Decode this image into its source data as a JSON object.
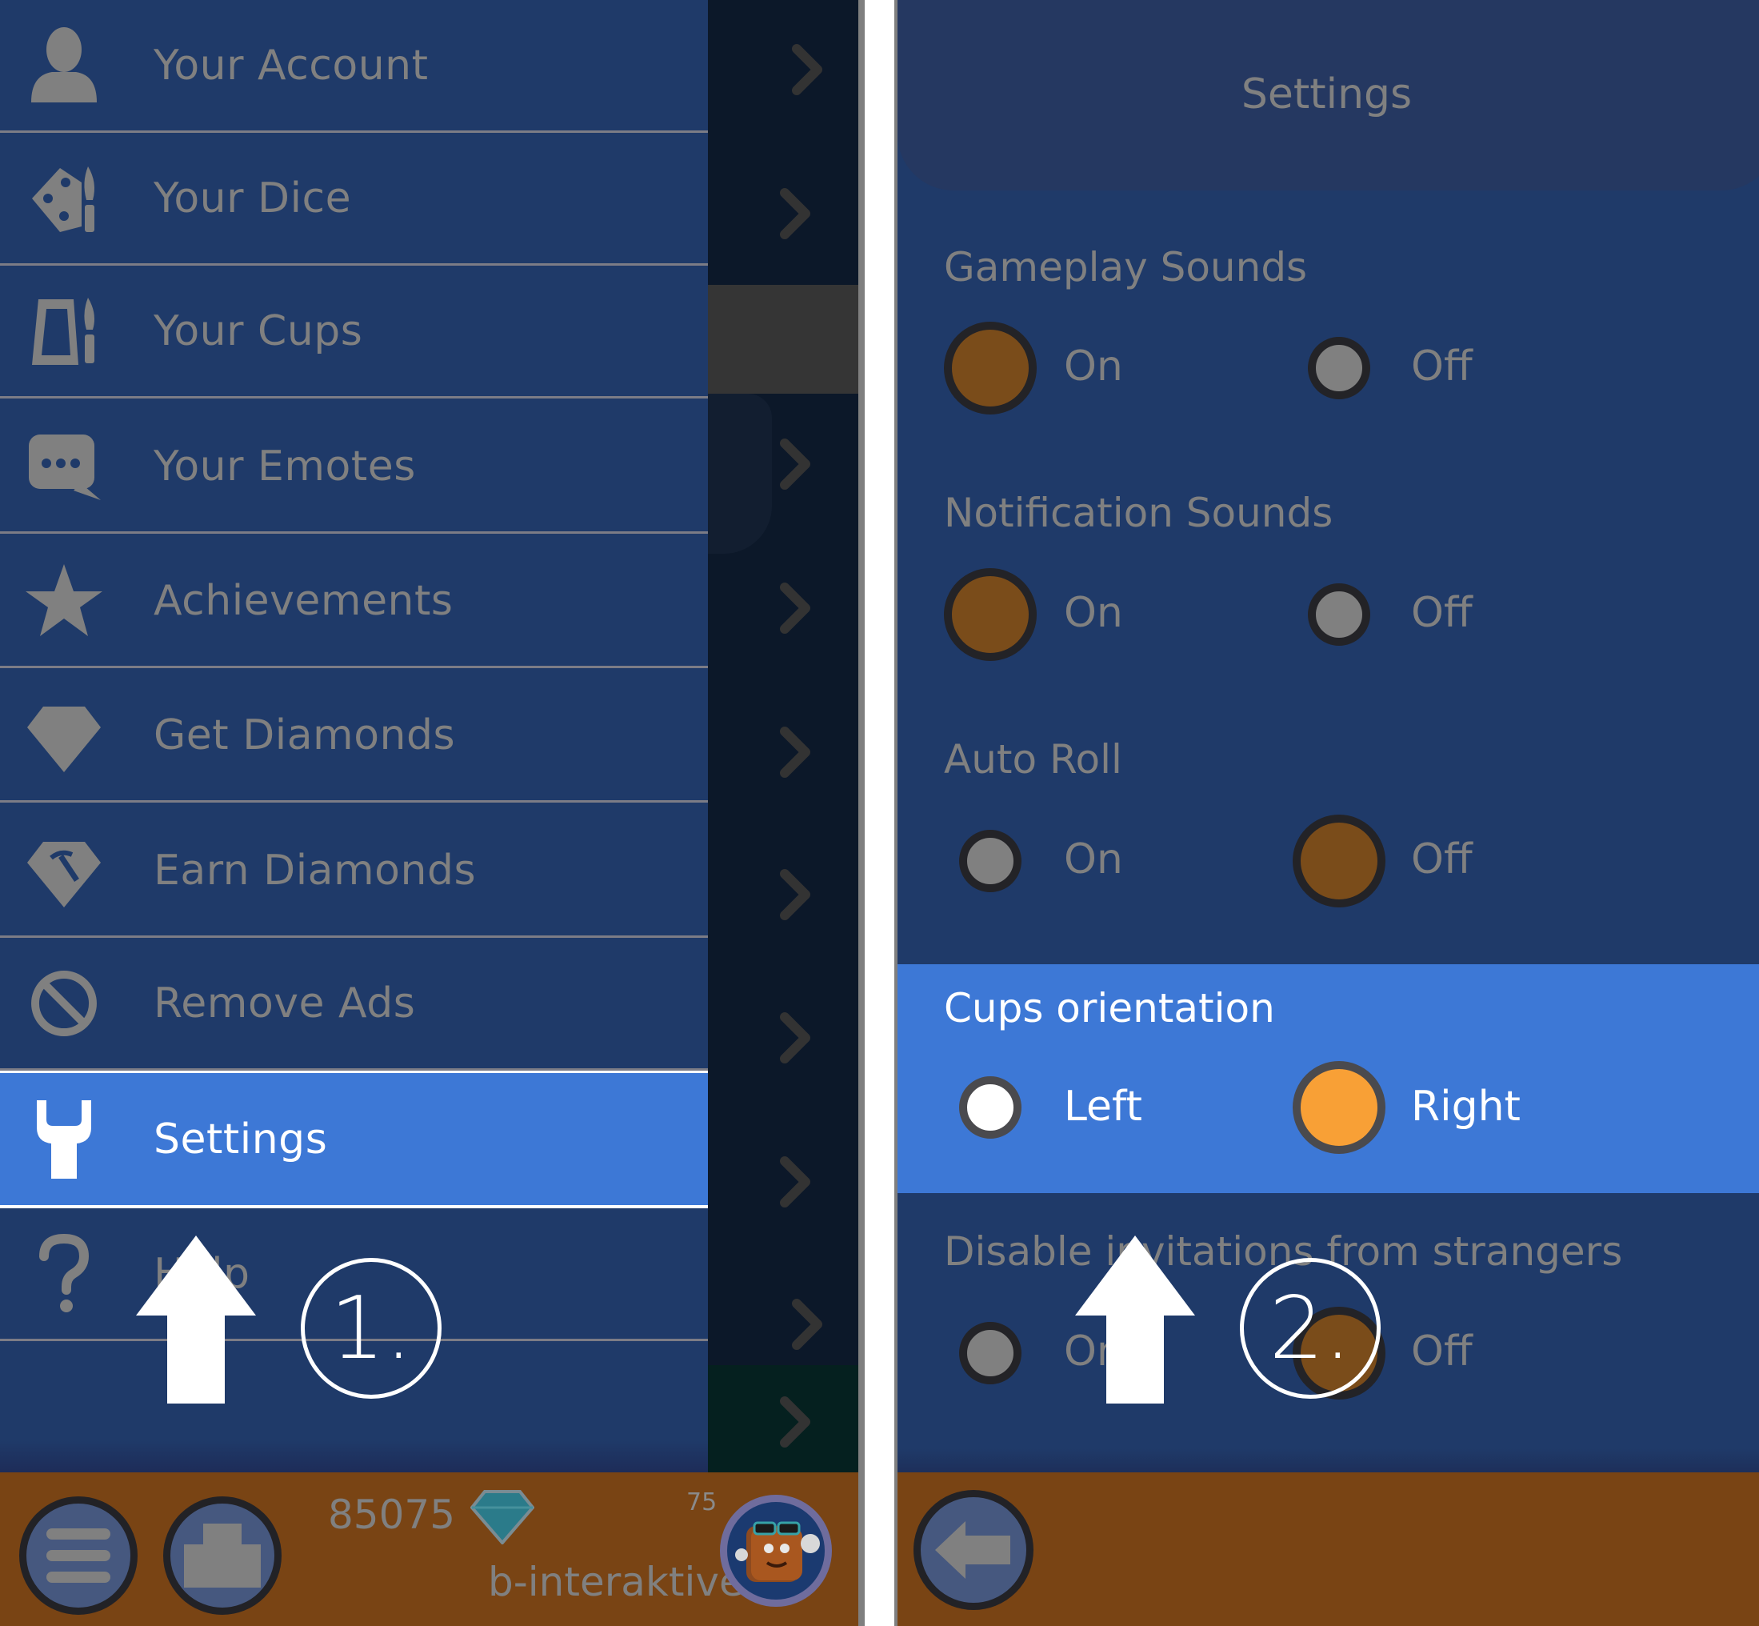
{
  "menu": {
    "items": [
      {
        "label": "Your Account",
        "icon": "user-icon"
      },
      {
        "label": "Your Dice",
        "icon": "dice-brush-icon"
      },
      {
        "label": "Your Cups",
        "icon": "cup-brush-icon"
      },
      {
        "label": "Your Emotes",
        "icon": "chat-bubble-icon"
      },
      {
        "label": "Achievements",
        "icon": "star-icon"
      },
      {
        "label": "Get Diamonds",
        "icon": "diamond-icon"
      },
      {
        "label": "Earn Diamonds",
        "icon": "diamond-pickaxe-icon"
      },
      {
        "label": "Remove Ads",
        "icon": "no-sign-icon"
      },
      {
        "label": "Settings",
        "icon": "wrench-icon",
        "active": true
      },
      {
        "label": "Help",
        "icon": "question-icon"
      }
    ]
  },
  "bottom_bar": {
    "diamonds": "85075",
    "level": "75",
    "username": "b-interaktive"
  },
  "settings": {
    "title": "Settings",
    "sections": [
      {
        "title": "Gameplay Sounds",
        "options": [
          "On",
          "Off"
        ],
        "selected": "On"
      },
      {
        "title": "Notification Sounds",
        "options": [
          "On",
          "Off"
        ],
        "selected": "On"
      },
      {
        "title": "Auto Roll",
        "options": [
          "On",
          "Off"
        ],
        "selected": "Off"
      },
      {
        "title": "Cups orientation",
        "options": [
          "Left",
          "Right"
        ],
        "selected": "Right",
        "highlighted": true
      },
      {
        "title": "Disable invitations from strangers",
        "options": [
          "On",
          "Off"
        ],
        "selected": "Off"
      }
    ]
  },
  "annotations": {
    "step1": "1.",
    "step2": "2."
  },
  "colors": {
    "panel_bg": "#1f3a69",
    "highlight": "#3d78d6",
    "selected_radio": "#7a4c1a",
    "selected_radio_highlight": "#f8a036",
    "bottom_bar": "#794414",
    "muted_text": "#808080"
  }
}
